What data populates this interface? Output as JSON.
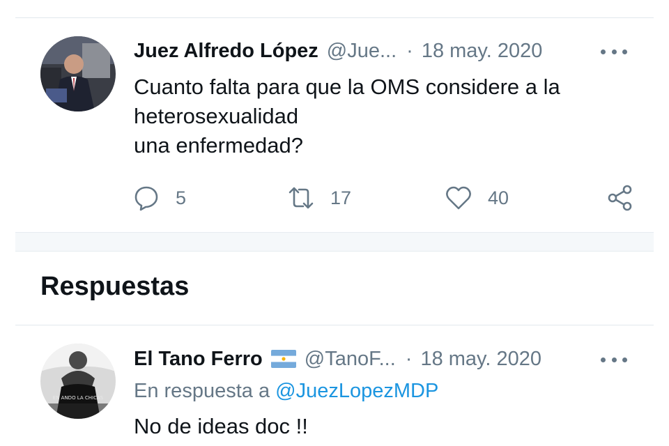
{
  "tweet": {
    "author_name": "Juez Alfredo López",
    "handle": "@Jue...",
    "separator": "·",
    "date": "18 may. 2020",
    "text": "Cuanto falta para que la OMS considere a la\nheterosexualidad\nuna enfermedad?",
    "actions": {
      "replies": "5",
      "retweets": "17",
      "likes": "40"
    }
  },
  "replies_section": {
    "title": "Respuestas"
  },
  "reply": {
    "author_name": "El Tano Ferro",
    "handle": "@TanoF...",
    "separator": "·",
    "date": "18 may. 2020",
    "reply_prefix": "En respuesta a ",
    "reply_mention": "@JuezLopezMDP",
    "text": "No de ideas doc !!",
    "avatar_text": "EN ANDO LA CHICAS"
  },
  "colors": {
    "text_primary": "#0f1419",
    "text_secondary": "#657786",
    "link": "#1b95e0",
    "divider": "#e1e8ed"
  },
  "icons": [
    "reply-icon",
    "retweet-icon",
    "like-icon",
    "share-icon",
    "more-icon",
    "argentina-flag-icon"
  ]
}
